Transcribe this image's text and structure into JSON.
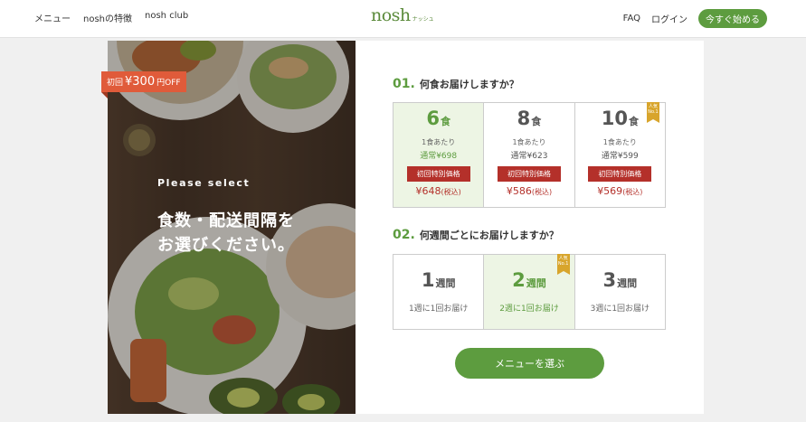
{
  "header": {
    "nav_left": [
      "メニュー",
      "noshの特徴",
      "nosh club"
    ],
    "logo": "nosh",
    "logo_sub": "ナッシュ",
    "faq": "FAQ",
    "login": "ログイン",
    "cta": "今すぐ始める"
  },
  "hero": {
    "badge_prefix": "初回",
    "badge_amount": "¥300",
    "badge_suffix": "円OFF",
    "please_select": "Please select",
    "headline_line1": "食数・配送間隔を",
    "headline_line2": "お選びください。"
  },
  "question1": {
    "number": "01.",
    "text": "何食お届けしますか？",
    "options": [
      {
        "count": "6",
        "unit": "食",
        "per_meal": "1食あたり",
        "regular": "通常¥698",
        "special": "初回特別価格",
        "price": "¥648",
        "tax": "(税込)",
        "selected": true,
        "popular": false
      },
      {
        "count": "8",
        "unit": "食",
        "per_meal": "1食あたり",
        "regular": "通常¥623",
        "special": "初回特別価格",
        "price": "¥586",
        "tax": "(税込)",
        "selected": false,
        "popular": false
      },
      {
        "count": "10",
        "unit": "食",
        "per_meal": "1食あたり",
        "regular": "通常¥599",
        "special": "初回特別価格",
        "price": "¥569",
        "tax": "(税込)",
        "selected": false,
        "popular": true
      }
    ]
  },
  "question2": {
    "number": "02.",
    "text": "何週間ごとにお届けしますか？",
    "options": [
      {
        "count": "1",
        "unit": "週間",
        "frequency": "1週に1回お届け",
        "selected": false,
        "popular": false
      },
      {
        "count": "2",
        "unit": "週間",
        "frequency": "2週に1回お届け",
        "selected": true,
        "popular": true
      },
      {
        "count": "3",
        "unit": "週間",
        "frequency": "3週に1回お届け",
        "selected": false,
        "popular": false
      }
    ]
  },
  "popular_label": "人気No.1",
  "select_button": "メニューを選ぶ",
  "colors": {
    "brand_green": "#5d9c3f",
    "selected_bg": "#edf5e4",
    "special_red": "#b4302a",
    "badge_orange": "#e05b3a",
    "ribbon_gold": "#d8a52c"
  }
}
